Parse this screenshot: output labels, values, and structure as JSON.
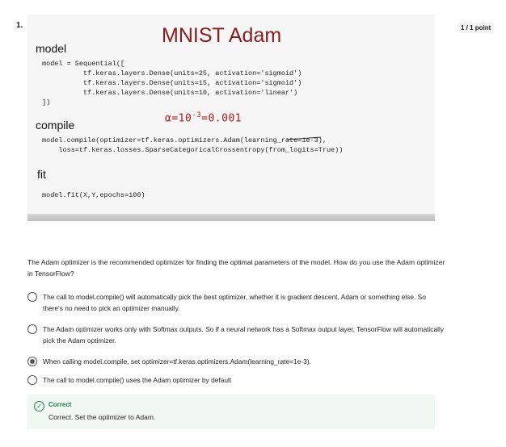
{
  "question_number": "1.",
  "points": "1 / 1 point",
  "slide": {
    "title": "MNIST Adam",
    "sections": {
      "model": "model",
      "compile": "compile",
      "fit": "fit"
    },
    "code_model": "model = Sequential([\n          tf.keras.layers.Dense(units=25, activation='sigmoid')\n          tf.keras.layers.Dense(units=15, activation='sigmoid')\n          tf.keras.layers.Dense(units=10, activation='linear')\n])",
    "code_compile": "model.compile(optimizer=tf.keras.optimizers.Adam(learning_rate=1e-3),\n    loss=tf.keras.losses.SparseCategoricalCrossentropy(from_logits=True))",
    "code_fit": "model.fit(X,Y,epochs=100)",
    "annotation_base": "α=10",
    "annotation_exp": "-3",
    "annotation_tail": "=0.001"
  },
  "question": "The Adam optimizer is the recommended optimizer for finding the optimal parameters of the model. How do you use the Adam optimizer in TensorFlow?",
  "options": [
    {
      "text": "The call to model.compile() will automatically pick the best optimizer, whether it is gradient descent, Adam or something else. So there's no need to pick an optimizer manually.",
      "selected": false
    },
    {
      "text": "The Adam optimizer works only with Softmax outputs. So if a neural network has a Softmax output layer, TensorFlow will automatically pick the Adam optimizer.",
      "selected": false
    },
    {
      "text": "When calling model.compile, set optimizer=tf.keras.optimizers.Adam(learning_rate=1e-3).",
      "selected": true
    },
    {
      "text": "The call to model.compile() uses the Adam optimizer by default",
      "selected": false
    }
  ],
  "feedback": {
    "label": "Correct",
    "message": "Correct. Set the optimizer to Adam.",
    "icon": "check-circle-icon",
    "color": "#1f8354"
  }
}
